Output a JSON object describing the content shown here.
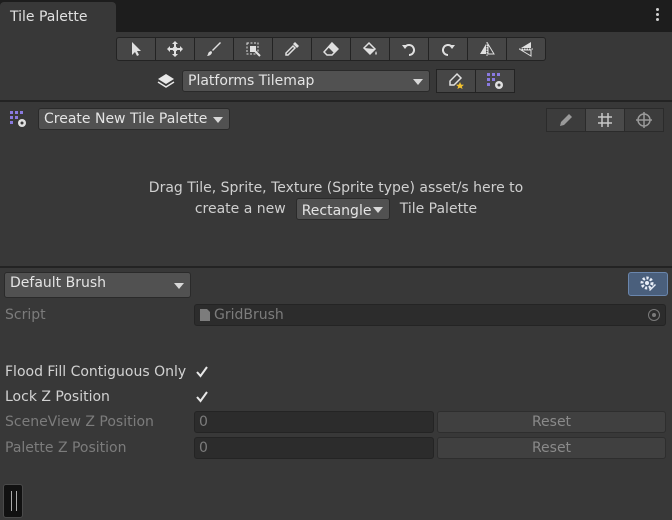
{
  "window": {
    "tab_title": "Tile Palette"
  },
  "tools": [
    {
      "name": "select-tool-button",
      "icon": "arrow-cursor-icon"
    },
    {
      "name": "move-tool-button",
      "icon": "move-arrows-icon"
    },
    {
      "name": "paint-tool-button",
      "icon": "brush-icon"
    },
    {
      "name": "box-fill-tool-button",
      "icon": "box-fill-icon"
    },
    {
      "name": "picker-tool-button",
      "icon": "eyedropper-icon"
    },
    {
      "name": "erase-tool-button",
      "icon": "eraser-icon"
    },
    {
      "name": "fill-tool-button",
      "icon": "paint-bucket-icon"
    },
    {
      "name": "rotate-ccw-button",
      "icon": "rotate-counterclockwise-icon"
    },
    {
      "name": "rotate-cw-button",
      "icon": "rotate-clockwise-icon"
    },
    {
      "name": "flip-x-button",
      "icon": "flip-horizontal-icon"
    },
    {
      "name": "flip-y-button",
      "icon": "flip-vertical-icon"
    }
  ],
  "active_target": {
    "value": "Platforms Tilemap"
  },
  "palette": {
    "selected": "Create New Tile Palette"
  },
  "drop_area": {
    "line1": "Drag Tile, Sprite, Texture (Sprite type) asset/s here to",
    "line2_prefix": "create a new",
    "grid_type": "Rectangle",
    "line2_suffix": "Tile Palette"
  },
  "brush": {
    "selected": "Default Brush",
    "script_label": "Script",
    "script_value": "GridBrush",
    "flood_fill_label": "Flood Fill Contiguous Only",
    "flood_fill_checked": true,
    "lock_z_label": "Lock Z Position",
    "lock_z_checked": true,
    "sceneview_z_label": "SceneView Z Position",
    "sceneview_z_value": "0",
    "palette_z_label": "Palette Z Position",
    "palette_z_value": "0",
    "reset_label": "Reset"
  },
  "colors": {
    "accent": "#4a5f7c",
    "panel": "#383838"
  }
}
